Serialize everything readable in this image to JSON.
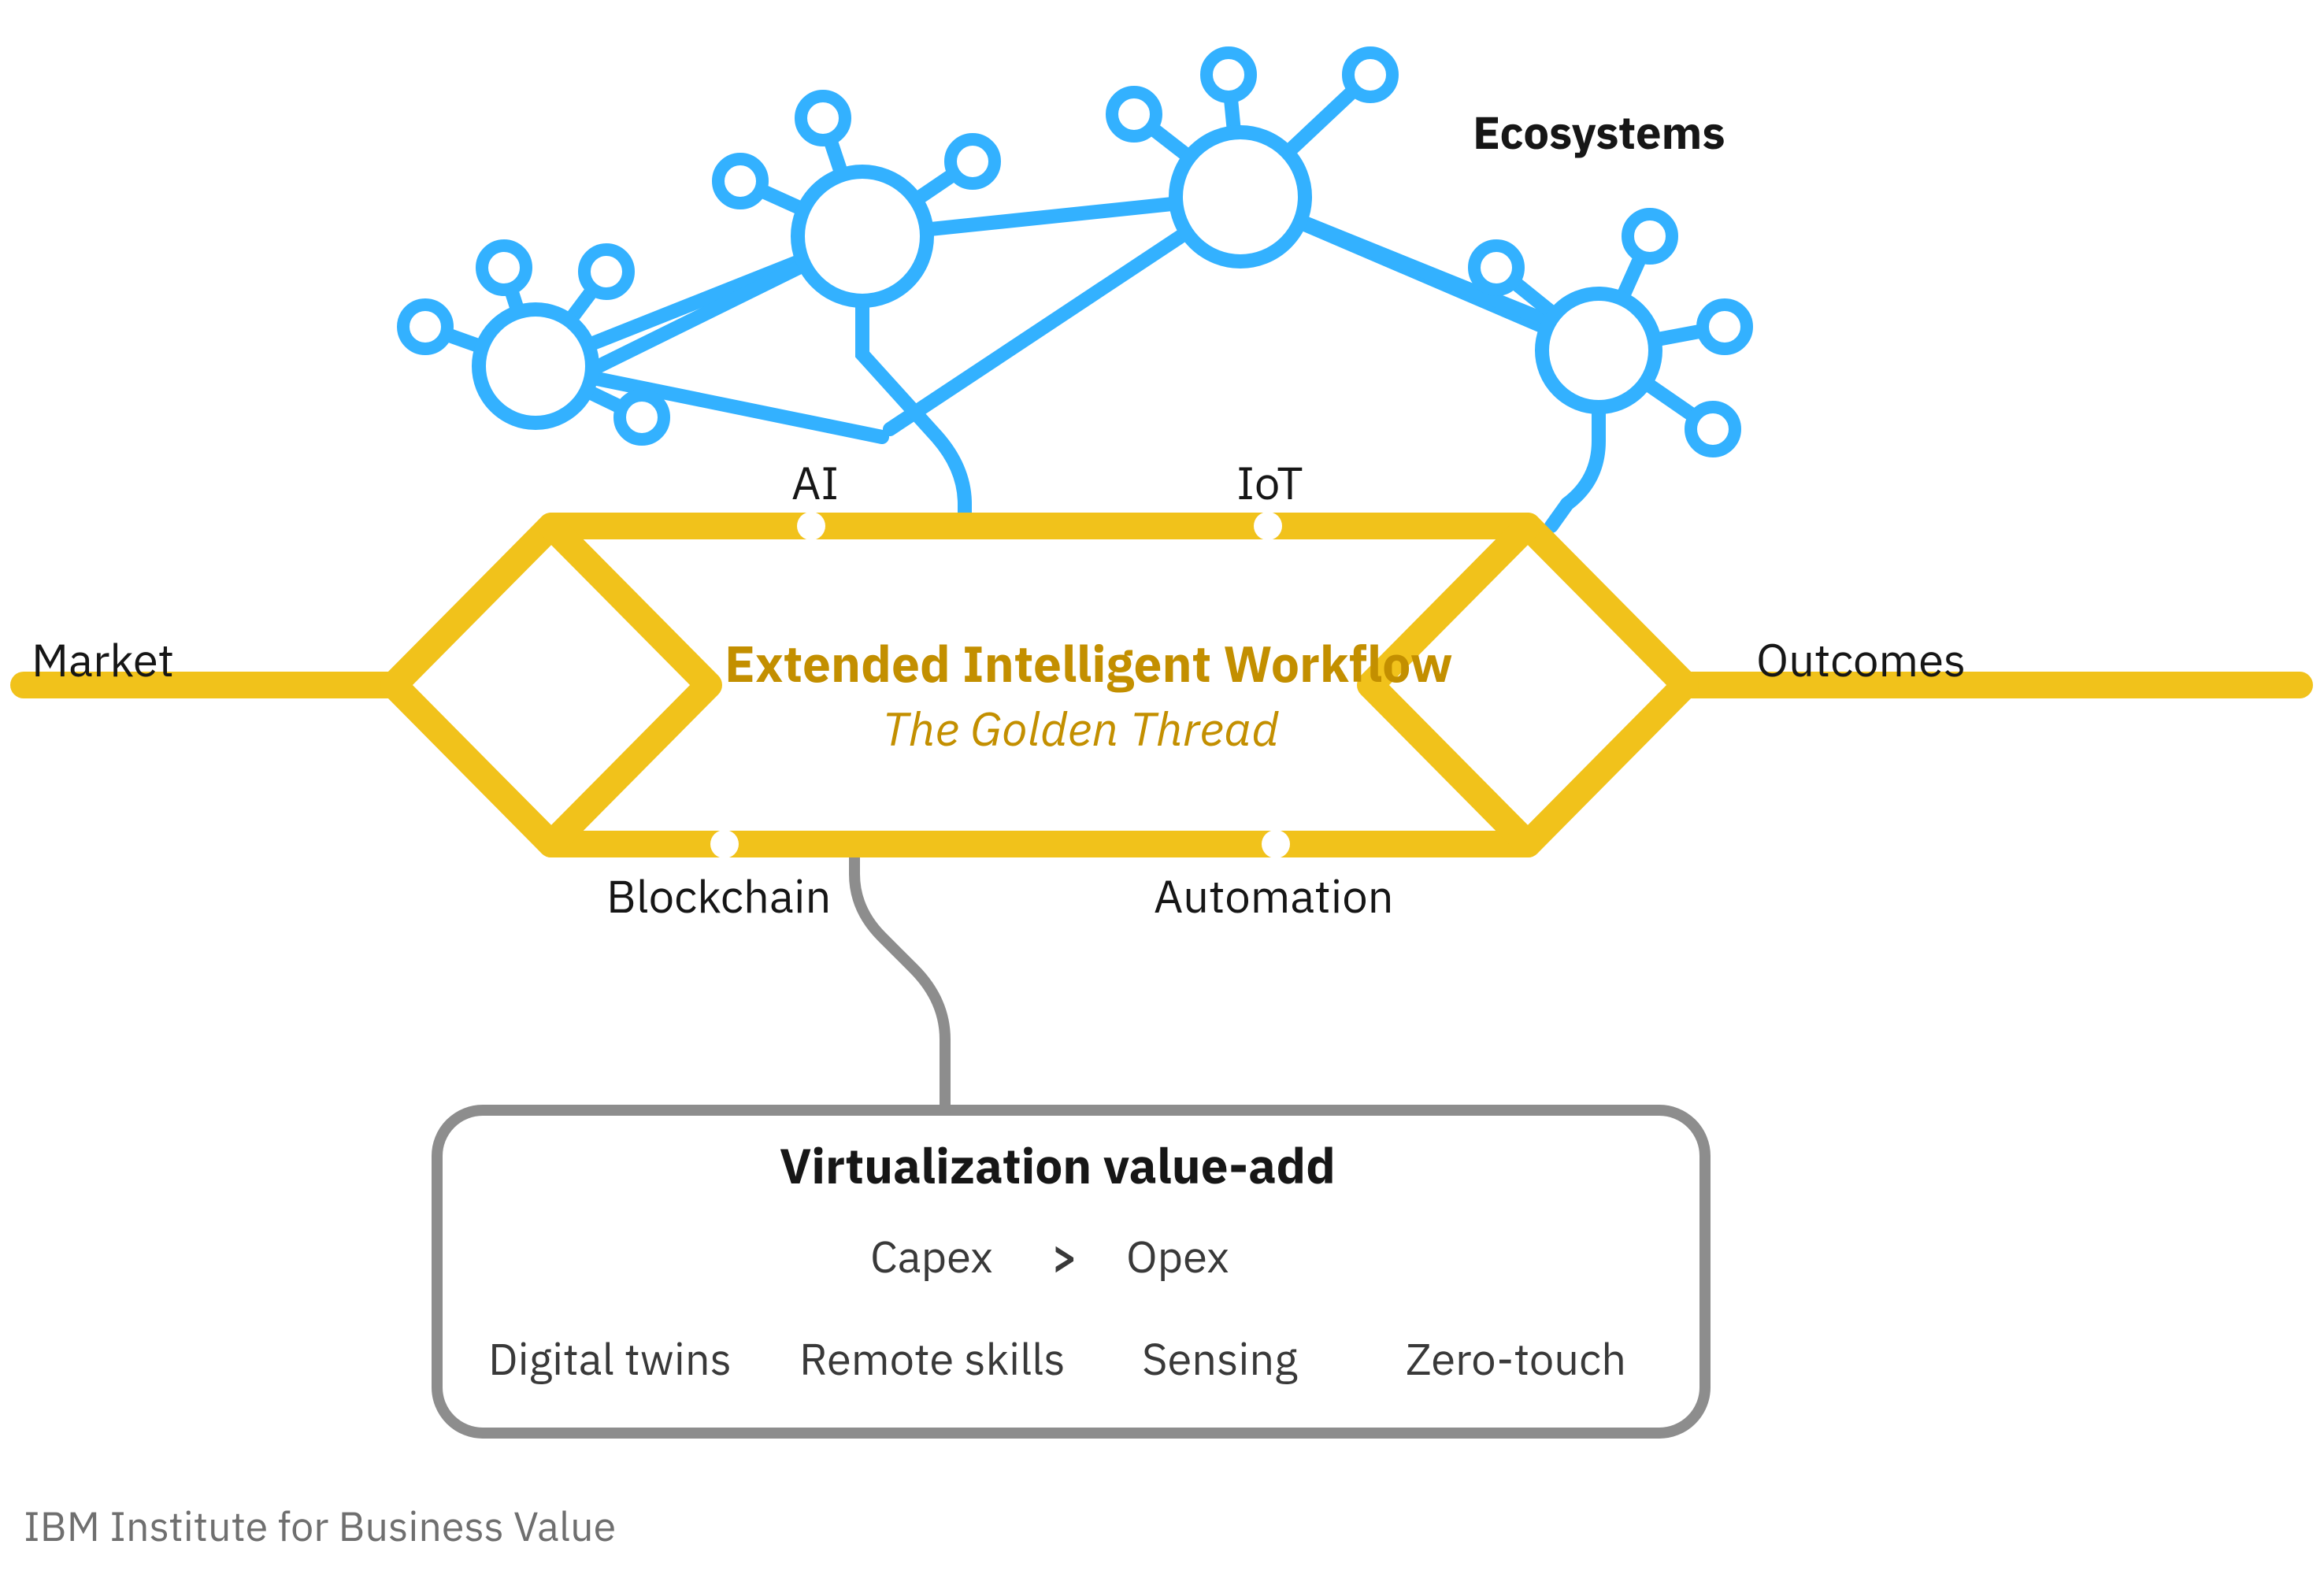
{
  "ecosystems_label": "Ecosystems",
  "market_label": "Market",
  "outcomes_label": "Outcomes",
  "top_tech_left": "AI",
  "top_tech_right": "IoT",
  "bottom_tech_left": "Blockchain",
  "bottom_tech_right": "Automation",
  "center": {
    "title": "Extended Intelligent Workflow",
    "subtitle": "The Golden Thread"
  },
  "value_box": {
    "title": "Virtualization value-add",
    "capex": "Capex",
    "arrow": ">",
    "opex": "Opex",
    "items": [
      "Digital twins",
      "Remote skills",
      "Sensing",
      "Zero-touch"
    ]
  },
  "footer": "IBM Institute for Business Value",
  "colors": {
    "blue": "#33b1ff",
    "gold": "#f1c21b",
    "gold_dark": "#c38f00",
    "gray": "#8d8d8d"
  }
}
